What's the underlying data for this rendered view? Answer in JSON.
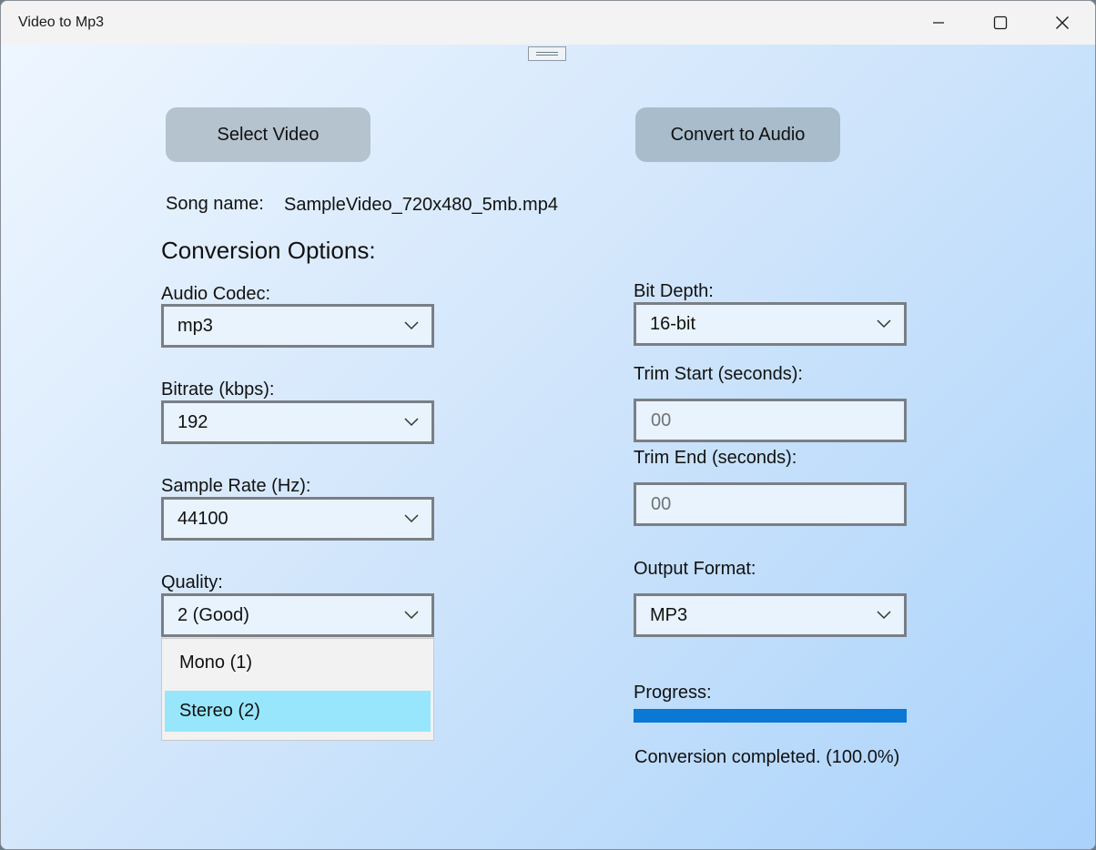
{
  "window": {
    "title": "Video to Mp3"
  },
  "buttons": {
    "select_video": "Select Video",
    "convert": "Convert to Audio"
  },
  "song": {
    "label": "Song name:",
    "value": "SampleVideo_720x480_5mb.mp4"
  },
  "options": {
    "heading": "Conversion Options:",
    "audio_codec": {
      "label": "Audio Codec:",
      "value": "mp3"
    },
    "bitrate": {
      "label": "Bitrate (kbps):",
      "value": "192"
    },
    "sample_rate": {
      "label": "Sample Rate (Hz):",
      "value": "44100"
    },
    "quality": {
      "label": "Quality:",
      "value": "2 (Good)"
    },
    "bit_depth": {
      "label": "Bit Depth:",
      "value": "16-bit"
    },
    "trim_start": {
      "label": "Trim Start (seconds):",
      "placeholder": "00"
    },
    "trim_end": {
      "label": "Trim End (seconds):",
      "placeholder": "00"
    },
    "output_format": {
      "label": "Output Format:",
      "value": "MP3"
    }
  },
  "dropdown": {
    "items": [
      {
        "label": "Mono (1)",
        "selected": false
      },
      {
        "label": "Stereo (2)",
        "selected": true
      }
    ]
  },
  "progress": {
    "label": "Progress:",
    "fraction": 1.0,
    "status": "Conversion completed. (100.0%)",
    "fill_color": "#0a78d4"
  },
  "icons": {
    "minimize": "minimize-icon",
    "maximize": "maximize-icon",
    "close": "close-icon",
    "chevron": "chevron-down-icon"
  }
}
